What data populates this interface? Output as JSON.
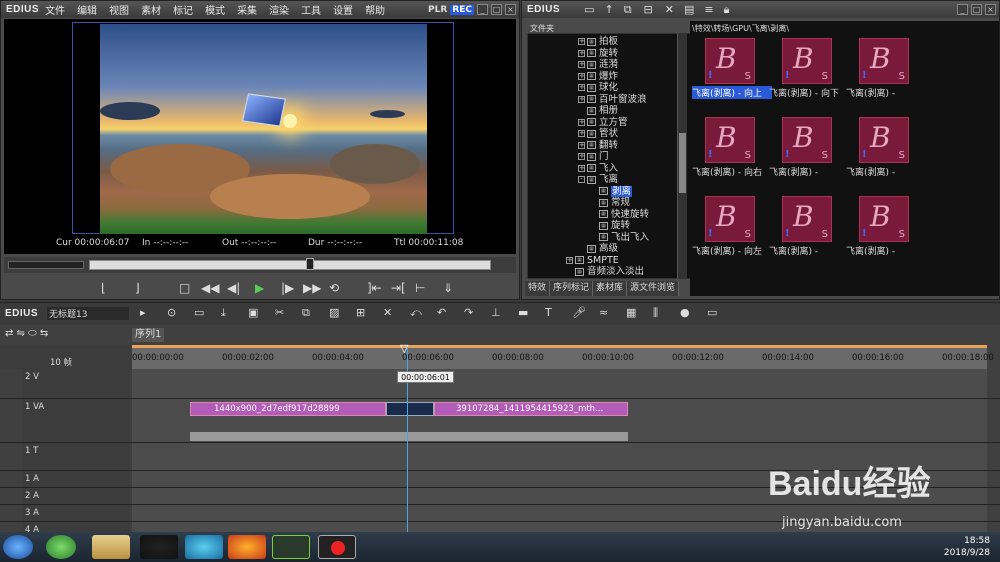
{
  "preview": {
    "logo": "EDIUS",
    "menu": [
      "文件",
      "编辑",
      "视图",
      "素材",
      "标记",
      "模式",
      "采集",
      "渲染",
      "工具",
      "设置",
      "帮助"
    ],
    "plr": "PLR",
    "rec": "REC",
    "cur": "Cur 00:00:06:07",
    "in": "In --:--:--:--",
    "out": "Out --:--:--:--",
    "dur": "Dur --:--:--:--",
    "ttl": "Ttl 00:00:11:08"
  },
  "bin": {
    "logo": "EDIUS",
    "folder_label": "文件夹",
    "path": "\\特效\\转场\\GPU\\飞离\\剥离\\",
    "tree": [
      {
        "label": "拍板",
        "depth": 1,
        "box": "+"
      },
      {
        "label": "旋转",
        "depth": 1,
        "box": "+"
      },
      {
        "label": "涟漪",
        "depth": 1,
        "box": "+"
      },
      {
        "label": "爆炸",
        "depth": 1,
        "box": "+"
      },
      {
        "label": "球化",
        "depth": 1,
        "box": "+"
      },
      {
        "label": "百叶窗波浪",
        "depth": 1,
        "box": "+"
      },
      {
        "label": "相册",
        "depth": 1,
        "box": ""
      },
      {
        "label": "立方管",
        "depth": 1,
        "box": "+"
      },
      {
        "label": "管状",
        "depth": 1,
        "box": "+"
      },
      {
        "label": "翻转",
        "depth": 1,
        "box": "+"
      },
      {
        "label": "门",
        "depth": 1,
        "box": "+"
      },
      {
        "label": "飞入",
        "depth": 1,
        "box": "+"
      },
      {
        "label": "飞离",
        "depth": 1,
        "box": "-"
      },
      {
        "label": "剥离",
        "depth": 2,
        "box": "",
        "selected": true
      },
      {
        "label": "常规",
        "depth": 2,
        "box": ""
      },
      {
        "label": "快速旋转",
        "depth": 2,
        "box": ""
      },
      {
        "label": "旋转",
        "depth": 2,
        "box": ""
      },
      {
        "label": "飞出飞入",
        "depth": 2,
        "box": ""
      },
      {
        "label": "高级",
        "depth": 1,
        "box": ""
      },
      {
        "label": "SMPTE",
        "depth": 0,
        "box": "+"
      },
      {
        "label": "音频淡入淡出",
        "depth": 0,
        "box": ""
      }
    ],
    "tabs": [
      "特效",
      "序列标记",
      "素材库",
      "源文件浏览"
    ],
    "clips": [
      {
        "label": "飞离(剥离) - 向上",
        "selected": true
      },
      {
        "label": "飞离(剥离) - 向下"
      },
      {
        "label": "飞离(剥离) -"
      },
      {
        "label": "飞离(剥离) - 向右"
      },
      {
        "label": "飞离(剥离) -"
      },
      {
        "label": "飞离(剥离) -"
      },
      {
        "label": "飞离(剥离) - 向左"
      },
      {
        "label": "飞离(剥离) -"
      },
      {
        "label": "飞离(剥离) -"
      }
    ]
  },
  "timeline": {
    "logo": "EDIUS",
    "project": "无标题13",
    "seq_tab": "序列1",
    "zoom": "10 帧",
    "ruler": [
      "00:00:00:00",
      "00:00:02:00",
      "00:00:04:00",
      "00:00:06:00",
      "00:00:08:00",
      "00:00:10:00",
      "00:00:12:00",
      "00:00:14:00",
      "00:00:16:00",
      "00:00:18:00"
    ],
    "playhead_tc": "00:00:06:01",
    "tracks": {
      "v2": "2 V",
      "va1": "1 VA",
      "t1": "1 T",
      "a1": "1 A",
      "a2": "2 A",
      "a3": "3 A",
      "a4": "4 A"
    },
    "clip1": "1440x900_2d7edf917d28899",
    "clip2": "39107284_1411954415923_mth..."
  },
  "taskbar": {
    "time": "18:58",
    "date": "2018/9/28"
  },
  "watermark": {
    "brand": "Baidu经验",
    "url": "jingyan.baidu.com"
  }
}
